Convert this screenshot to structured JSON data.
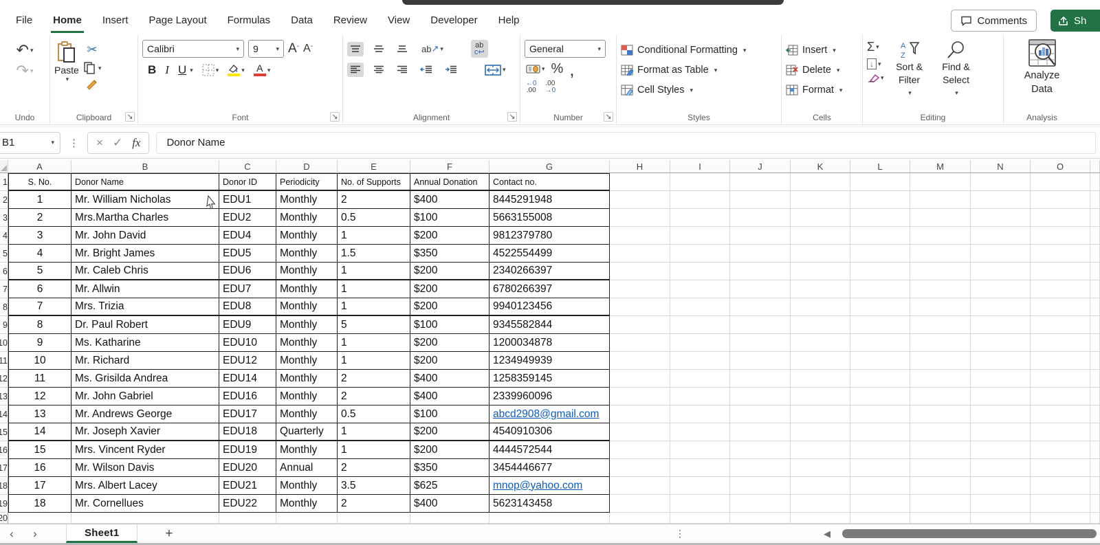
{
  "accent_color": "#217346",
  "link_color": "#0b5cc4",
  "titlebar": {
    "comments_label": "Comments",
    "share_label": "Sh"
  },
  "tabs": [
    {
      "label": "File",
      "active": false
    },
    {
      "label": "Home",
      "active": true
    },
    {
      "label": "Insert",
      "active": false
    },
    {
      "label": "Page Layout",
      "active": false
    },
    {
      "label": "Formulas",
      "active": false
    },
    {
      "label": "Data",
      "active": false
    },
    {
      "label": "Review",
      "active": false
    },
    {
      "label": "View",
      "active": false
    },
    {
      "label": "Developer",
      "active": false
    },
    {
      "label": "Help",
      "active": false
    }
  ],
  "ribbon": {
    "undo": {
      "label": "Undo"
    },
    "clipboard": {
      "label": "Clipboard",
      "paste_label": "Paste"
    },
    "font": {
      "label": "Font",
      "font_name": "Calibri",
      "font_size": "9"
    },
    "alignment": {
      "label": "Alignment"
    },
    "number": {
      "label": "Number",
      "format": "General"
    },
    "styles": {
      "label": "Styles",
      "items": [
        "Conditional Formatting",
        "Format as Table",
        "Cell Styles"
      ]
    },
    "cells": {
      "label": "Cells",
      "items": [
        "Insert",
        "Delete",
        "Format"
      ]
    },
    "editing": {
      "label": "Editing",
      "sort_filter": "Sort & Filter",
      "find_select": "Find & Select"
    },
    "analysis": {
      "label": "Analysis",
      "analyze_line1": "Analyze",
      "analyze_line2": "Data"
    }
  },
  "icons": {
    "undo": "↶",
    "redo": "↷",
    "dropdown": "▾",
    "dialog_launcher": "↘",
    "scissors": "✂",
    "bold": "B",
    "italic": "I",
    "underline": "U",
    "grow_font": "A",
    "grow_caret": "ˆ",
    "shrink_font": "A",
    "shrink_caret": "ˇ",
    "orientation": "ab",
    "orientation_arrow": "↗",
    "wrap_line1": "ab",
    "wrap_line2": "c↩",
    "percent": "%",
    "comma": ",",
    "inc_decimal_top": "←0",
    "inc_decimal_bottom": ".00",
    "dec_decimal_top": ".00",
    "dec_decimal_bottom": "→0",
    "sigma": "Σ",
    "fill_arrow": "↓",
    "sort_a": "A",
    "sort_z": "Z",
    "fx": "fx",
    "cancel": "×",
    "enter": "✓",
    "more_dots": "⋮",
    "prev_sheet": "‹",
    "next_sheet": "›",
    "add_sheet": "+",
    "scroll_left_arrow": "◀",
    "sheet_dots": "⋮"
  },
  "formula_bar": {
    "name_box": "B1",
    "formula": "Donor Name"
  },
  "grid": {
    "column_letters": [
      "A",
      "B",
      "C",
      "D",
      "E",
      "F",
      "G",
      "H",
      "I",
      "J",
      "K",
      "L",
      "M",
      "N",
      "O"
    ],
    "row_numbers": [
      "1",
      "2",
      "3",
      "4",
      "5",
      "6",
      "7",
      "8",
      "9",
      "10",
      "11",
      "12",
      "13",
      "14",
      "15",
      "16",
      "17",
      "18",
      "19",
      "20"
    ],
    "table": {
      "headers": [
        "S. No.",
        "Donor Name",
        "Donor ID",
        "Periodicity",
        "No. of Supports",
        "Annual Donation",
        "Contact no."
      ],
      "rows": [
        [
          "1",
          "Mr. William Nicholas",
          "EDU1",
          "Monthly",
          "2",
          "$400",
          "8445291948"
        ],
        [
          "2",
          "Mrs.Martha Charles",
          "EDU2",
          "Monthly",
          "0.5",
          "$100",
          "5663155008"
        ],
        [
          "3",
          "Mr. John David",
          "EDU4",
          "Monthly",
          "1",
          "$200",
          "9812379780"
        ],
        [
          "4",
          "Mr. Bright James",
          "EDU5",
          "Monthly",
          "1.5",
          "$350",
          "4522554499"
        ],
        [
          "5",
          "Mr. Caleb Chris",
          "EDU6",
          "Monthly",
          "1",
          "$200",
          "2340266397"
        ],
        [
          "6",
          "Mr. Allwin",
          "EDU7",
          "Monthly",
          "1",
          "$200",
          "6780266397"
        ],
        [
          "7",
          "Mrs. Trizia",
          "EDU8",
          "Monthly",
          "1",
          "$200",
          "9940123456"
        ],
        [
          "8",
          "Dr. Paul Robert",
          "EDU9",
          "Monthly",
          "5",
          "$100",
          "9345582844"
        ],
        [
          "9",
          "Ms. Katharine",
          "EDU10",
          "Monthly",
          "1",
          "$200",
          "1200034878"
        ],
        [
          "10",
          "Mr. Richard",
          "EDU12",
          "Monthly",
          "1",
          "$200",
          "1234949939"
        ],
        [
          "11",
          "Ms. Grisilda Andrea",
          "EDU14",
          "Monthly",
          "2",
          "$400",
          "1258359145"
        ],
        [
          "12",
          "Mr. John Gabriel",
          "EDU16",
          "Monthly",
          "2",
          "$400",
          "2339960096"
        ],
        [
          "13",
          "Mr. Andrews George",
          "EDU17",
          "Monthly",
          "0.5",
          "$100",
          "abcd2908@gmail.com"
        ],
        [
          "14",
          "Mr. Joseph Xavier",
          "EDU18",
          "Quarterly",
          "1",
          "$200",
          "4540910306"
        ],
        [
          "15",
          "Mrs. Vincent Ryder",
          "EDU19",
          "Monthly",
          "1",
          "$200",
          "4444572544"
        ],
        [
          "16",
          "Mr. Wilson Davis",
          "EDU20",
          "Annual",
          "2",
          "$350",
          "3454446677"
        ],
        [
          "17",
          "Mrs. Albert Lacey",
          "EDU21",
          "Monthly",
          "3.5",
          "$625",
          "mnop@yahoo.com"
        ],
        [
          "18",
          "Mr. Cornellues",
          "EDU22",
          "Monthly",
          "2",
          "$400",
          "5623143458"
        ]
      ],
      "thick_bottom_rows": [
        4,
        6,
        13
      ]
    }
  },
  "sheet_bar": {
    "sheet_name": "Sheet1"
  }
}
